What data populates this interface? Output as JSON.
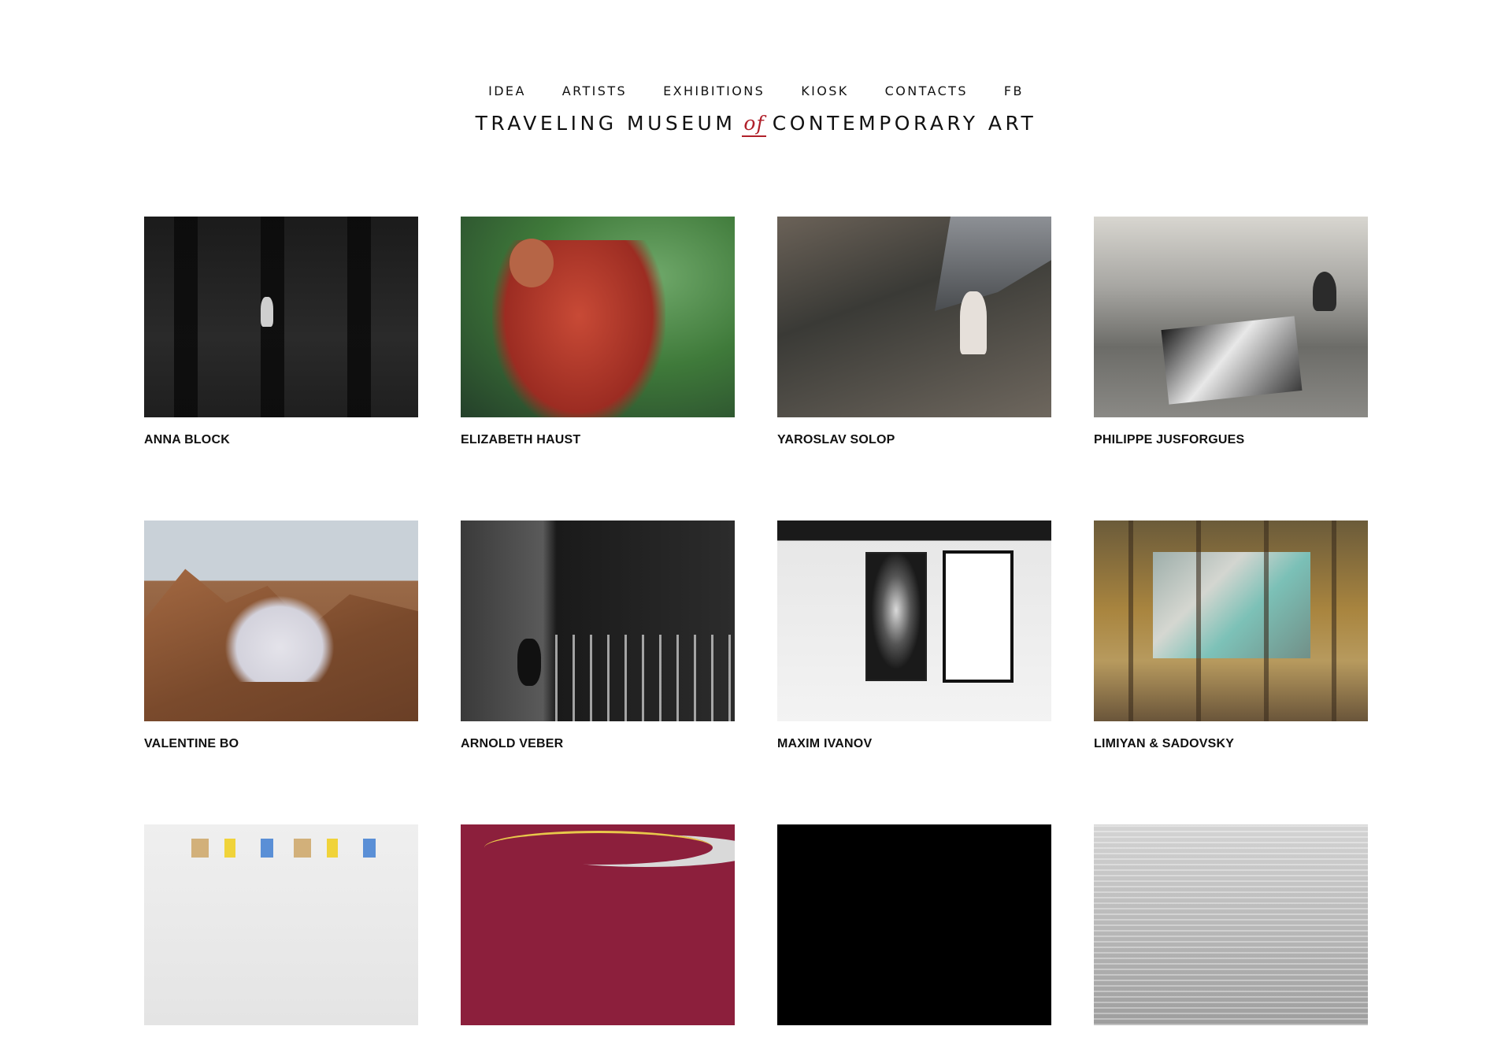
{
  "nav": {
    "items": [
      {
        "label": "IDEA"
      },
      {
        "label": "ARTISTS"
      },
      {
        "label": "EXHIBITIONS"
      },
      {
        "label": "KIOSK"
      },
      {
        "label": "CONTACTS"
      },
      {
        "label": "FB"
      }
    ]
  },
  "logo": {
    "part1": "TRAVELING MUSEUM",
    "of": "of",
    "part2": "CONTEMPORARY ART",
    "accent_color": "#b0202a"
  },
  "artists": [
    {
      "name": "ANNA BLOCK"
    },
    {
      "name": "ELIZABETH HAUST"
    },
    {
      "name": "YAROSLAV SOLOP"
    },
    {
      "name": "PHILIPPE JUSFORGUES"
    },
    {
      "name": "VALENTINE BO"
    },
    {
      "name": "ARNOLD VEBER"
    },
    {
      "name": "MAXIM IVANOV"
    },
    {
      "name": "LIMIYAN & SADOVSKY"
    },
    {
      "name": ""
    },
    {
      "name": ""
    },
    {
      "name": ""
    },
    {
      "name": ""
    }
  ]
}
